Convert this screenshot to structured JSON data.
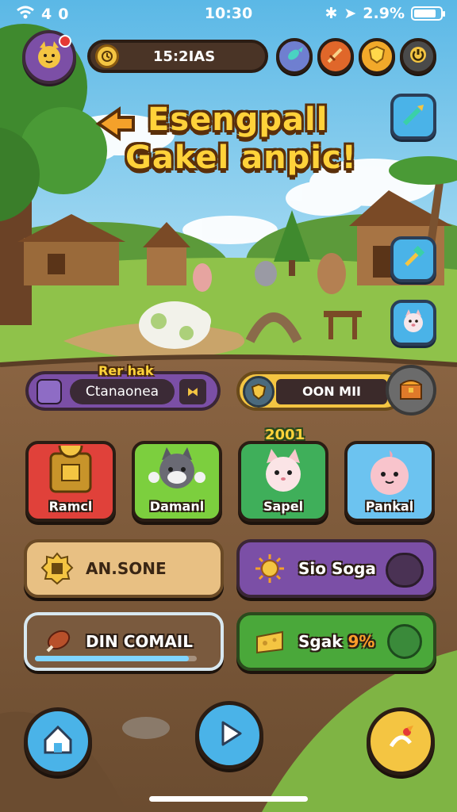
{
  "status_bar": {
    "signal": "4",
    "network": "0",
    "time": "10:30",
    "indicators": "2.9%",
    "battery_level": 0.85
  },
  "hud": {
    "timer": "15:2IAS",
    "icons": [
      "avatar-cat-icon",
      "notification-badge",
      "clock-icon",
      "fish-icon",
      "sword-icon",
      "gold-shield-icon",
      "power-icon"
    ]
  },
  "title": {
    "line1": "Esengpall",
    "line2": "Gakel anpic!"
  },
  "left_panel": {
    "label": "Rer hak",
    "field": "Ctanaonea",
    "action": "⧓"
  },
  "right_panel": {
    "field": "OON MII"
  },
  "cards": {
    "badge": "2001",
    "items": [
      {
        "label": "Ramcl",
        "color": "#e0413a"
      },
      {
        "label": "Damanl",
        "color": "#7ccf3e"
      },
      {
        "label": "Sapel",
        "color": "#3faf5a"
      },
      {
        "label": "Pankal",
        "color": "#6cc3f0"
      }
    ]
  },
  "actions": {
    "a1": {
      "label": "AN.SONE"
    },
    "a2": {
      "label": "Sio Soga"
    },
    "a3": {
      "label": "DIN COMAIL",
      "progress": 0.95
    },
    "a4": {
      "label": "Sgak",
      "accent": "9%"
    }
  },
  "nav": {
    "home": "home-icon",
    "play": "play-icon",
    "special": "special-icon"
  },
  "colors": {
    "sky": "#6ec6ea",
    "grass": "#8fc24a",
    "dirt": "#7a5a3c",
    "gold": "#f4c542",
    "purple": "#7b4fa6"
  }
}
